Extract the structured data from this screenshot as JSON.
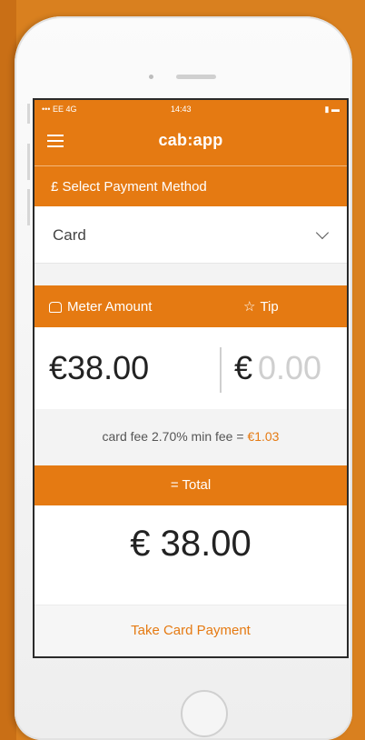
{
  "statusbar": {
    "left": "••• EE 4G",
    "time": "14:43",
    "battery": "▮ ▬"
  },
  "app": {
    "title": "cab:app"
  },
  "payment_method": {
    "label": "£ Select Payment Method",
    "selected": "Card"
  },
  "amounts": {
    "meter_label": "Meter Amount",
    "tip_label": "Tip",
    "meter_value": "€38.00",
    "tip_currency": "€",
    "tip_value": "0.00"
  },
  "fee": {
    "text": "card fee 2.70% min fee = ",
    "amount": "€1.03"
  },
  "total": {
    "label": "= Total",
    "value": "€ 38.00"
  },
  "actions": {
    "take_payment": "Take Card Payment"
  },
  "colors": {
    "accent": "#e57a12",
    "background": "#d9801f"
  }
}
